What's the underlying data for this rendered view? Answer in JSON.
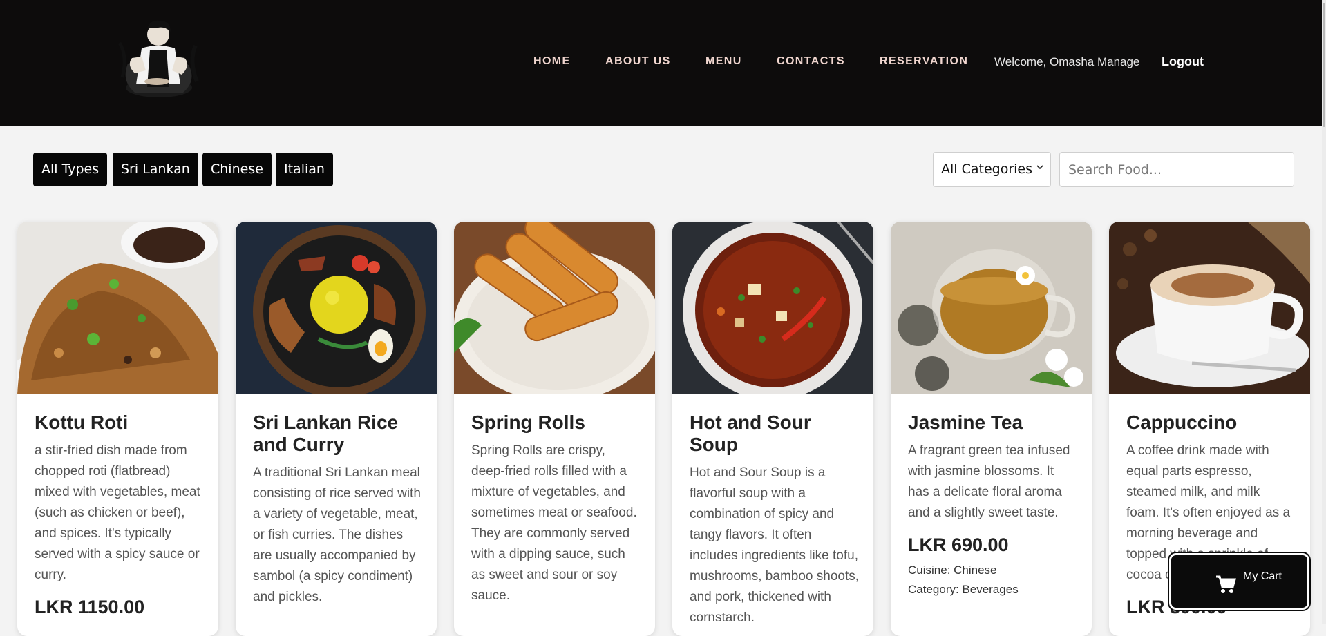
{
  "header": {
    "logo_icon": "chef-logo-icon",
    "nav": [
      {
        "label": "HOME"
      },
      {
        "label": "ABOUT US"
      },
      {
        "label": "MENU"
      },
      {
        "label": "CONTACTS"
      },
      {
        "label": "RESERVATION"
      }
    ],
    "welcome": "Welcome, Omasha Manage",
    "logout": "Logout"
  },
  "filters": {
    "types": [
      "All Types",
      "Sri Lankan",
      "Chinese",
      "Italian"
    ],
    "category_selected": "All Categories",
    "search_placeholder": "Search Food..."
  },
  "foods": [
    {
      "name": "Kottu Roti",
      "description": "a stir-fried dish made from chopped roti (flatbread) mixed with vegetables, meat (such as chicken or beef), and spices. It's typically served with a spicy sauce or curry.",
      "price": "LKR 1150.00",
      "image": "kottu-roti-photo"
    },
    {
      "name": "Sri Lankan Rice and Curry",
      "description": "A traditional Sri Lankan meal consisting of rice served with a variety of vegetable, meat, or fish curries. The dishes are usually accompanied by sambol (a spicy condiment) and pickles.",
      "price": "",
      "image": "rice-and-curry-photo"
    },
    {
      "name": "Spring Rolls",
      "description": "Spring Rolls are crispy, deep-fried rolls filled with a mixture of vegetables, and sometimes meat or seafood. They are commonly served with a dipping sauce, such as sweet and sour or soy sauce.",
      "price": "",
      "image": "spring-rolls-photo"
    },
    {
      "name": "Hot and Sour Soup",
      "description": "Hot and Sour Soup is a flavorful soup with a combination of spicy and tangy flavors. It often includes ingredients like tofu, mushrooms, bamboo shoots, and pork, thickened with cornstarch.",
      "price": "",
      "image": "hot-sour-soup-photo"
    },
    {
      "name": "Jasmine Tea",
      "description": "A fragrant green tea infused with jasmine blossoms. It has a delicate floral aroma and a slightly sweet taste.",
      "price": "LKR 690.00",
      "cuisine": "Cuisine: Chinese",
      "category": "Category: Beverages",
      "image": "jasmine-tea-photo"
    },
    {
      "name": "Cappuccino",
      "description": "A coffee drink made with equal parts espresso, steamed milk, and milk foam. It's often enjoyed as a morning beverage and topped with a sprinkle of cocoa or cinnamon.",
      "price": "LKR 800.00",
      "image": "cappuccino-photo"
    }
  ],
  "cart": {
    "label": "My Cart",
    "icon": "cart-icon"
  },
  "colors": {
    "header_bg": "#0d0c0c",
    "nav_text": "#f0d6cf",
    "page_bg": "#f3f3f3",
    "button_bg": "#070707"
  }
}
